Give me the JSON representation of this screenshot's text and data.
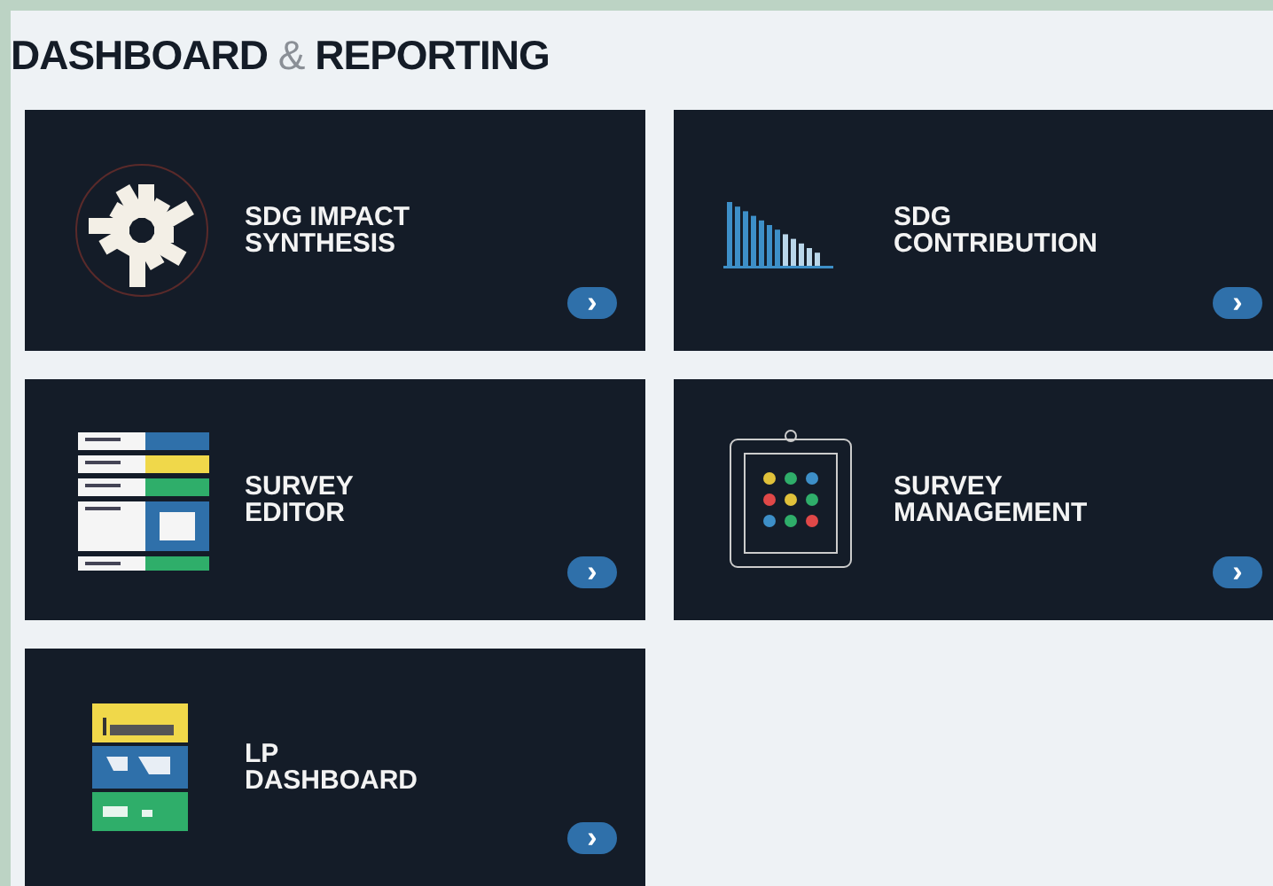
{
  "header": {
    "title": "**DASHBOARD** & **REPORTING**"
  },
  "tiles": [
    {
      "title_lines": [
        "SDG IMPACT",
        "SYNTHESIS"
      ],
      "arrow": "›"
    },
    {
      "title_lines": [
        "SDG",
        "CONTRIBUTION"
      ],
      "arrow": "›"
    },
    {
      "title_lines": [
        "SURVEY",
        "EDITOR"
      ],
      "arrow": "›"
    },
    {
      "title_lines": [
        "SURVEY",
        "MANAGEMENT"
      ],
      "arrow": "›"
    },
    {
      "title_lines": [
        "LP",
        "DASHBOARD"
      ],
      "arrow": "›"
    }
  ]
}
